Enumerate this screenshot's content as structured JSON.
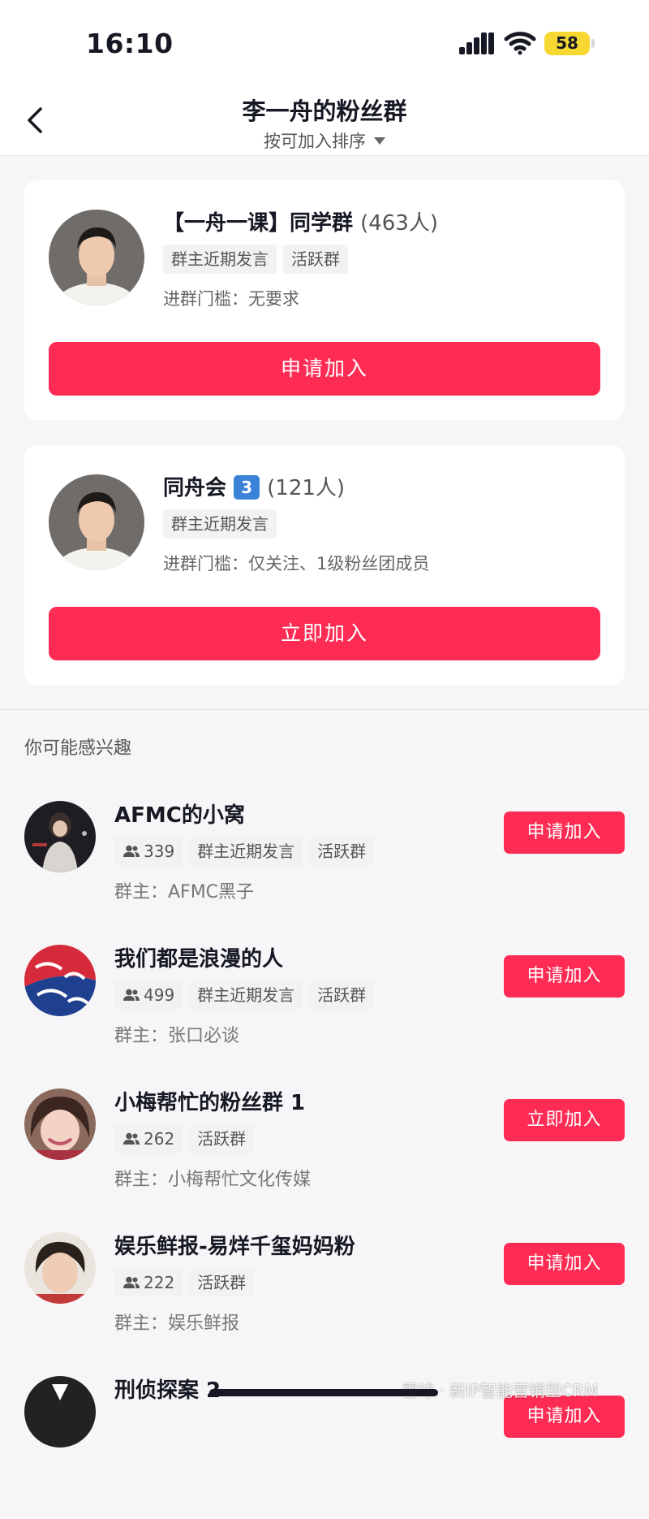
{
  "status_bar": {
    "time": "16:10",
    "battery": "58"
  },
  "nav": {
    "title": "李一舟的粉丝群",
    "sort_label": "按可加入排序"
  },
  "groups": [
    {
      "name": "【一舟一课】同学群",
      "count": "(463人)",
      "tags": [
        "群主近期发言",
        "活跃群"
      ],
      "requirement": "进群门槛：无要求",
      "button": "申请加入"
    },
    {
      "name": "同舟会",
      "badge": "3",
      "count": "(121人)",
      "tags": [
        "群主近期发言"
      ],
      "requirement": "进群门槛：仅关注、1级粉丝团成员",
      "button": "立即加入"
    }
  ],
  "suggest": {
    "title": "你可能感兴趣",
    "items": [
      {
        "name": "AFMC的小窝",
        "members": "339",
        "tags": [
          "群主近期发言",
          "活跃群"
        ],
        "owner": "群主：AFMC黑子",
        "button": "申请加入"
      },
      {
        "name": "我们都是浪漫的人",
        "members": "499",
        "tags": [
          "群主近期发言",
          "活跃群"
        ],
        "owner": "群主：张口必谈",
        "button": "申请加入"
      },
      {
        "name": "小梅帮忙的粉丝群 1",
        "members": "262",
        "tags": [
          "活跃群"
        ],
        "owner": "群主：小梅帮忙文化传媒",
        "button": "立即加入"
      },
      {
        "name": "娱乐鲜报-易烊千玺妈妈粉",
        "members": "222",
        "tags": [
          "活跃群"
        ],
        "owner": "群主：娱乐鲜报",
        "button": "申请加入"
      },
      {
        "name": "刑侦探案 2",
        "button": "申请加入"
      }
    ]
  },
  "watermark": "雪球 · 新IP智能营销型CRM",
  "colors": {
    "accent": "#fe2c55",
    "battery": "#f7d731",
    "badge": "#3b82d9"
  }
}
